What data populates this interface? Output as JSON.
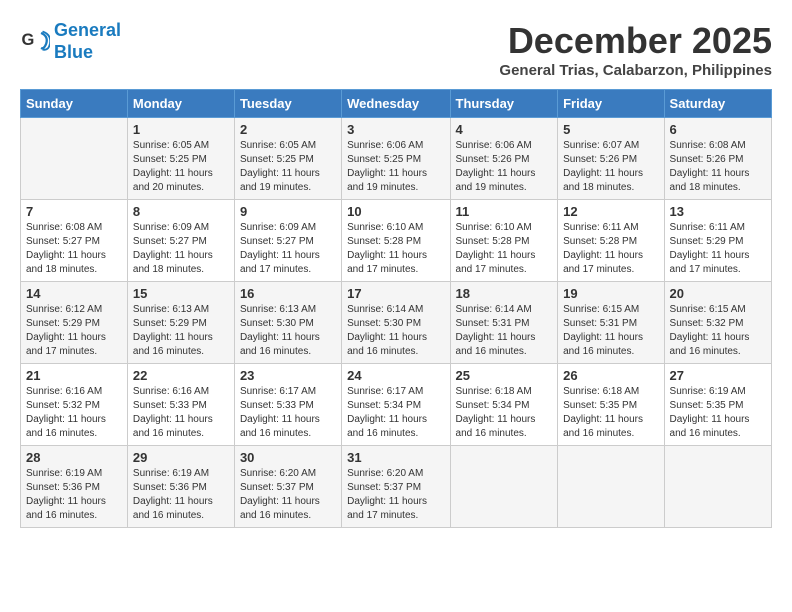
{
  "header": {
    "logo_line1": "General",
    "logo_line2": "Blue",
    "month_title": "December 2025",
    "location": "General Trias, Calabarzon, Philippines"
  },
  "days_of_week": [
    "Sunday",
    "Monday",
    "Tuesday",
    "Wednesday",
    "Thursday",
    "Friday",
    "Saturday"
  ],
  "weeks": [
    [
      {
        "day": "",
        "info": ""
      },
      {
        "day": "1",
        "info": "Sunrise: 6:05 AM\nSunset: 5:25 PM\nDaylight: 11 hours\nand 20 minutes."
      },
      {
        "day": "2",
        "info": "Sunrise: 6:05 AM\nSunset: 5:25 PM\nDaylight: 11 hours\nand 19 minutes."
      },
      {
        "day": "3",
        "info": "Sunrise: 6:06 AM\nSunset: 5:25 PM\nDaylight: 11 hours\nand 19 minutes."
      },
      {
        "day": "4",
        "info": "Sunrise: 6:06 AM\nSunset: 5:26 PM\nDaylight: 11 hours\nand 19 minutes."
      },
      {
        "day": "5",
        "info": "Sunrise: 6:07 AM\nSunset: 5:26 PM\nDaylight: 11 hours\nand 18 minutes."
      },
      {
        "day": "6",
        "info": "Sunrise: 6:08 AM\nSunset: 5:26 PM\nDaylight: 11 hours\nand 18 minutes."
      }
    ],
    [
      {
        "day": "7",
        "info": "Sunrise: 6:08 AM\nSunset: 5:27 PM\nDaylight: 11 hours\nand 18 minutes."
      },
      {
        "day": "8",
        "info": "Sunrise: 6:09 AM\nSunset: 5:27 PM\nDaylight: 11 hours\nand 18 minutes."
      },
      {
        "day": "9",
        "info": "Sunrise: 6:09 AM\nSunset: 5:27 PM\nDaylight: 11 hours\nand 17 minutes."
      },
      {
        "day": "10",
        "info": "Sunrise: 6:10 AM\nSunset: 5:28 PM\nDaylight: 11 hours\nand 17 minutes."
      },
      {
        "day": "11",
        "info": "Sunrise: 6:10 AM\nSunset: 5:28 PM\nDaylight: 11 hours\nand 17 minutes."
      },
      {
        "day": "12",
        "info": "Sunrise: 6:11 AM\nSunset: 5:28 PM\nDaylight: 11 hours\nand 17 minutes."
      },
      {
        "day": "13",
        "info": "Sunrise: 6:11 AM\nSunset: 5:29 PM\nDaylight: 11 hours\nand 17 minutes."
      }
    ],
    [
      {
        "day": "14",
        "info": "Sunrise: 6:12 AM\nSunset: 5:29 PM\nDaylight: 11 hours\nand 17 minutes."
      },
      {
        "day": "15",
        "info": "Sunrise: 6:13 AM\nSunset: 5:29 PM\nDaylight: 11 hours\nand 16 minutes."
      },
      {
        "day": "16",
        "info": "Sunrise: 6:13 AM\nSunset: 5:30 PM\nDaylight: 11 hours\nand 16 minutes."
      },
      {
        "day": "17",
        "info": "Sunrise: 6:14 AM\nSunset: 5:30 PM\nDaylight: 11 hours\nand 16 minutes."
      },
      {
        "day": "18",
        "info": "Sunrise: 6:14 AM\nSunset: 5:31 PM\nDaylight: 11 hours\nand 16 minutes."
      },
      {
        "day": "19",
        "info": "Sunrise: 6:15 AM\nSunset: 5:31 PM\nDaylight: 11 hours\nand 16 minutes."
      },
      {
        "day": "20",
        "info": "Sunrise: 6:15 AM\nSunset: 5:32 PM\nDaylight: 11 hours\nand 16 minutes."
      }
    ],
    [
      {
        "day": "21",
        "info": "Sunrise: 6:16 AM\nSunset: 5:32 PM\nDaylight: 11 hours\nand 16 minutes."
      },
      {
        "day": "22",
        "info": "Sunrise: 6:16 AM\nSunset: 5:33 PM\nDaylight: 11 hours\nand 16 minutes."
      },
      {
        "day": "23",
        "info": "Sunrise: 6:17 AM\nSunset: 5:33 PM\nDaylight: 11 hours\nand 16 minutes."
      },
      {
        "day": "24",
        "info": "Sunrise: 6:17 AM\nSunset: 5:34 PM\nDaylight: 11 hours\nand 16 minutes."
      },
      {
        "day": "25",
        "info": "Sunrise: 6:18 AM\nSunset: 5:34 PM\nDaylight: 11 hours\nand 16 minutes."
      },
      {
        "day": "26",
        "info": "Sunrise: 6:18 AM\nSunset: 5:35 PM\nDaylight: 11 hours\nand 16 minutes."
      },
      {
        "day": "27",
        "info": "Sunrise: 6:19 AM\nSunset: 5:35 PM\nDaylight: 11 hours\nand 16 minutes."
      }
    ],
    [
      {
        "day": "28",
        "info": "Sunrise: 6:19 AM\nSunset: 5:36 PM\nDaylight: 11 hours\nand 16 minutes."
      },
      {
        "day": "29",
        "info": "Sunrise: 6:19 AM\nSunset: 5:36 PM\nDaylight: 11 hours\nand 16 minutes."
      },
      {
        "day": "30",
        "info": "Sunrise: 6:20 AM\nSunset: 5:37 PM\nDaylight: 11 hours\nand 16 minutes."
      },
      {
        "day": "31",
        "info": "Sunrise: 6:20 AM\nSunset: 5:37 PM\nDaylight: 11 hours\nand 17 minutes."
      },
      {
        "day": "",
        "info": ""
      },
      {
        "day": "",
        "info": ""
      },
      {
        "day": "",
        "info": ""
      }
    ]
  ]
}
